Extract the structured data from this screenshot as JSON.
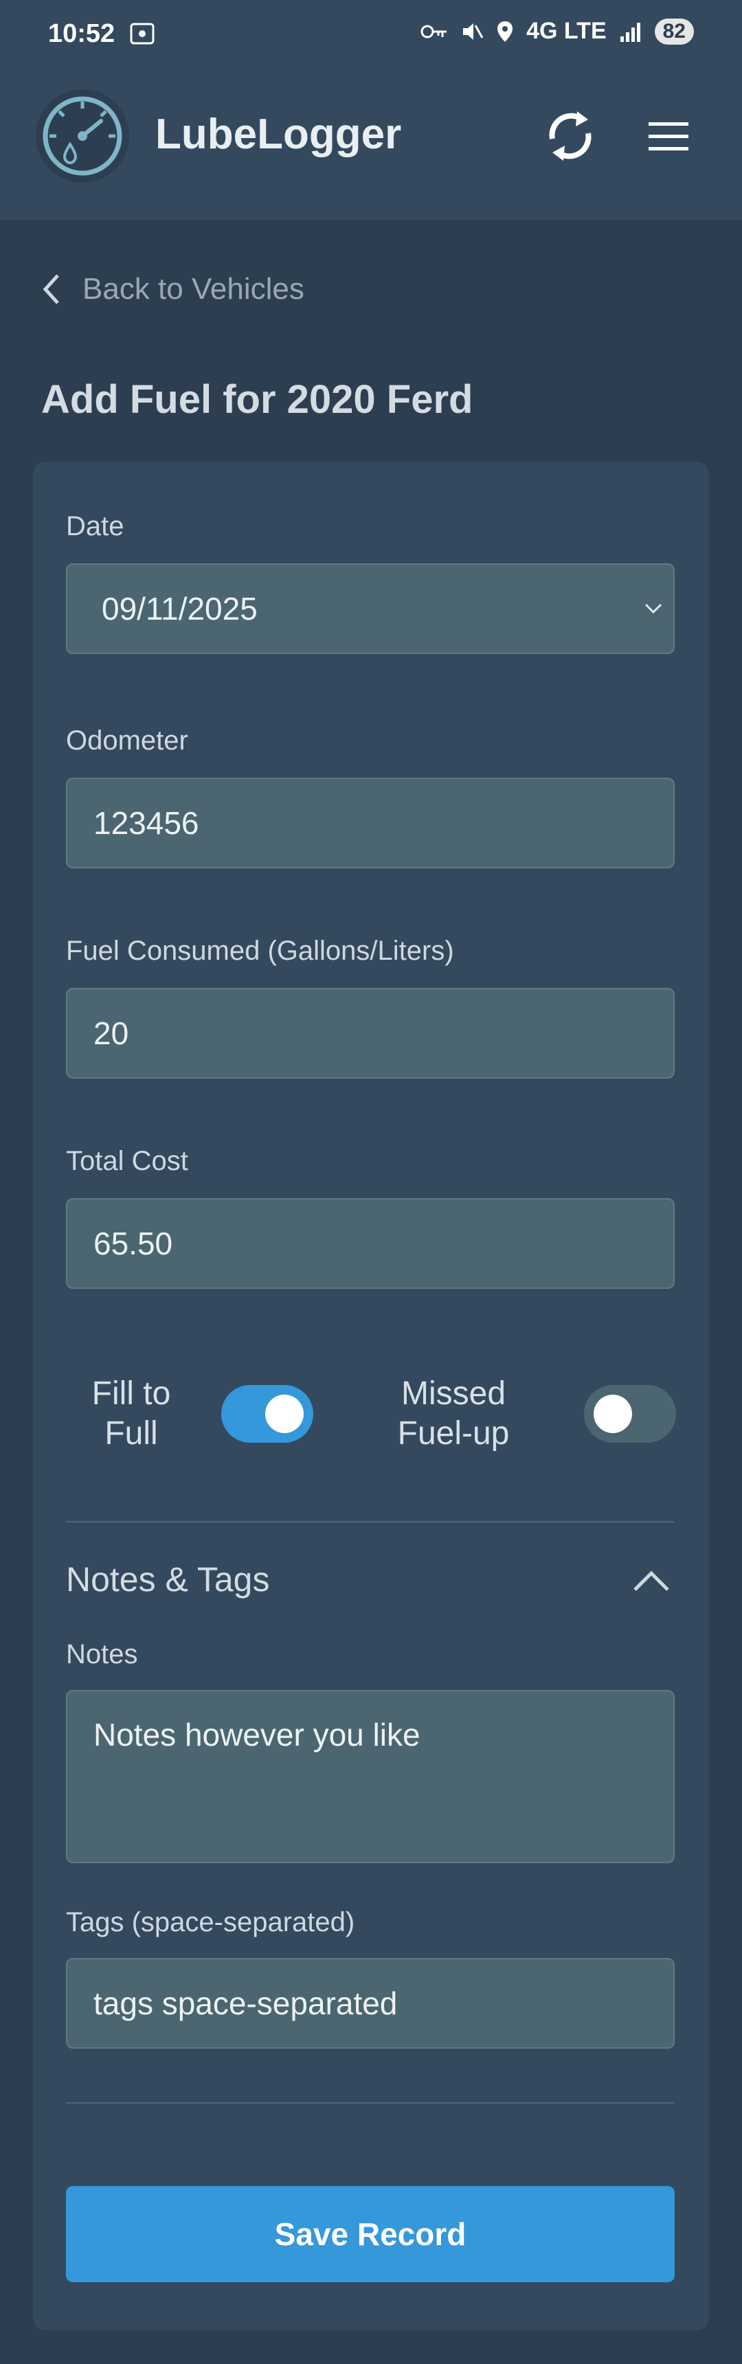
{
  "status": {
    "time": "10:52",
    "network": "4G LTE",
    "battery": "82"
  },
  "app": {
    "title": "LubeLogger"
  },
  "nav": {
    "back_label": "Back to Vehicles"
  },
  "page": {
    "title": "Add Fuel for 2020 Ferd"
  },
  "form": {
    "date_label": "Date",
    "date_value": "09/11/2025",
    "odometer_label": "Odometer",
    "odometer_value": "123456",
    "fuel_label": "Fuel Consumed (Gallons/Liters)",
    "fuel_value": "20",
    "cost_label": "Total Cost",
    "cost_value": "65.50",
    "fill_to_full_label": "Fill to Full",
    "fill_to_full": true,
    "missed_fuelup_label": "Missed Fuel-up",
    "missed_fuelup": false,
    "notes_section_label": "Notes & Tags",
    "notes_label": "Notes",
    "notes_placeholder": "Notes however you like",
    "tags_label": "Tags (space-separated)",
    "tags_placeholder": "tags space-separated",
    "save_label": "Save Record"
  },
  "colors": {
    "background": "#2c3e50",
    "card": "#34495e",
    "input": "#4b6670",
    "accent": "#3498db"
  },
  "icons": [
    "screenshot-icon",
    "key-icon",
    "mute-icon",
    "location-icon",
    "signal-icon",
    "gauge-logo-icon",
    "sync-icon",
    "hamburger-menu-icon",
    "chevron-left-icon",
    "chevron-down-icon",
    "chevron-up-icon"
  ]
}
